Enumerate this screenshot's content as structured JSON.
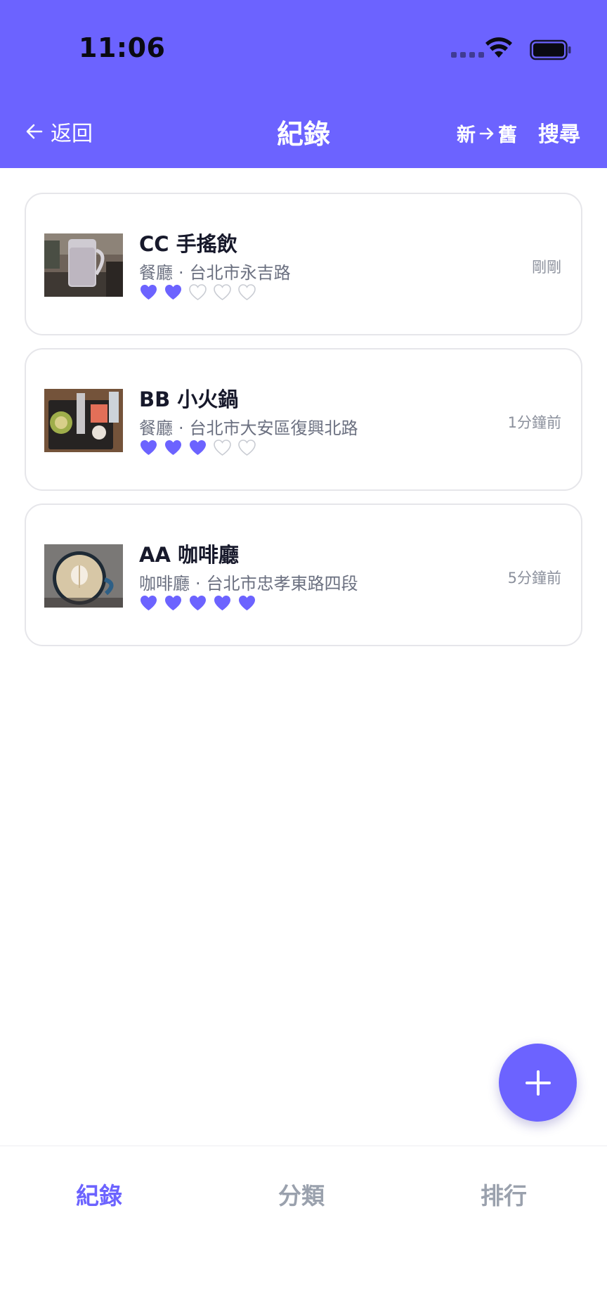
{
  "status_bar": {
    "time": "11:06"
  },
  "nav": {
    "back_label": "返回",
    "title": "紀錄",
    "sort_from": "新",
    "sort_to": "舊",
    "search_label": "搜尋"
  },
  "records": [
    {
      "name": "CC 手搖飲",
      "category": "餐廳",
      "address": "台北市永吉路",
      "separator": "·",
      "rating": 2,
      "max_rating": 5,
      "time": "剛剛"
    },
    {
      "name": "BB 小火鍋",
      "category": "餐廳",
      "address": "台北市大安區復興北路",
      "separator": "·",
      "rating": 3,
      "max_rating": 5,
      "time": "1分鐘前"
    },
    {
      "name": "AA 咖啡廳",
      "category": "咖啡廳",
      "address": "台北市忠孝東路四段",
      "separator": "·",
      "rating": 5,
      "max_rating": 5,
      "time": "5分鐘前"
    }
  ],
  "tabs": [
    {
      "label": "紀錄",
      "active": true
    },
    {
      "label": "分類",
      "active": false
    },
    {
      "label": "排行",
      "active": false
    }
  ],
  "colors": {
    "accent": "#6c63ff",
    "heart_filled": "#6c63ff",
    "heart_empty": "#c9ccd3"
  },
  "icons": {
    "back": "arrow-left-icon",
    "sort_arrow": "arrow-right-icon",
    "fab": "plus-icon"
  }
}
